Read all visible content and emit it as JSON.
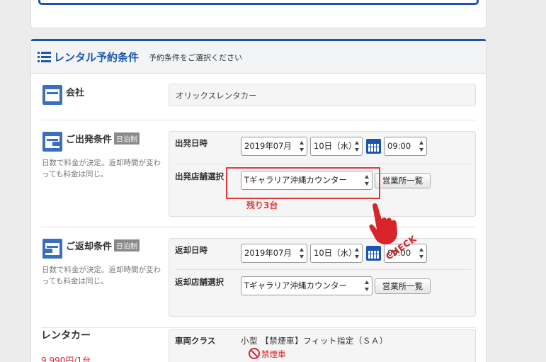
{
  "section": {
    "title": "レンタル予約条件",
    "subtitle": "予約条件をご選択ください"
  },
  "company": {
    "label": "会社",
    "value": "オリックスレンタカー"
  },
  "departure": {
    "label": "ご出発条件",
    "tag": "日泊制",
    "note": "日数で料金が決定。返却時間が変わっても料金は同じ。",
    "date_label": "出発日時",
    "month": "2019年07月",
    "day": "10日（水）",
    "time": "09:00",
    "store_label": "出発店舗選択",
    "store": "Tギャラリア沖縄カウンター",
    "store_list_button": "営業所一覧",
    "remaining": "残り3台"
  },
  "return": {
    "label": "ご返却条件",
    "tag": "日泊制",
    "note": "日数で料金が決定。返却時間が変わっても料金は同じ。",
    "date_label": "返却日時",
    "month": "2019年07月",
    "day": "10日（水）",
    "time": "09:00",
    "store_label": "返却店舗選択",
    "store": "Tギャラリア沖縄カウンター",
    "store_list_button": "営業所一覧"
  },
  "annotation": {
    "check": "CHECK"
  },
  "car": {
    "label": "レンタカー",
    "class_label": "車両クラス",
    "class_value": "小型 【禁煙車】フィット指定（ＳＡ）",
    "nosmoke": "禁煙車",
    "price": "9,990円/1台"
  },
  "colors": {
    "accent": "#1a56b0",
    "highlight": "#e23a3a",
    "icon": "#3a6fbf"
  }
}
